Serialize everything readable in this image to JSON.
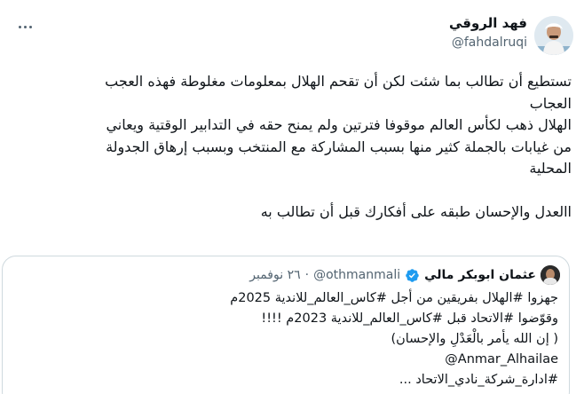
{
  "author": {
    "name": "فهد الروقي",
    "handle": "@fahdalruqi"
  },
  "tweet_lines": [
    "تستطيع أن تطالب بما شئت لكن أن تقحم الهلال بمعلومات مغلوطة فهذه العجب",
    "العجاب",
    "الهلال ذهب لكأس العالم موقوفا فترتين ولم يمنح حقه في التدابير الوقتية ويعاني",
    "من غيابات بالجملة كثير منها بسبب المشاركة مع المنتخب وبسبب إرهاق الجدولة",
    "المحلية",
    "",
    "االعدل والإحسان طبقه على أفكارك قبل أن تطالب به"
  ],
  "quote": {
    "name": "عثمان ابوبكر مالي",
    "handle": "@othmanmali",
    "separator": "·",
    "date": "٢٦ نوفمبر",
    "lines": [
      "جهزوا #الهلال بفريقين من أجل #كاس_العالم_للاندية 2025م",
      "وقوّضوا #الاتحاد قبل #كاس_العالم_للاندية 2023م !!!!",
      "( إن الله يأمر بالْعَدْلِ والإحسان)",
      "@Anmar_Alhailae",
      "#ادارة_شركة_نادي_الاتحاد ..."
    ]
  },
  "colors": {
    "text": "#0f1419",
    "secondary": "#536471",
    "border": "#cfd9de",
    "verified": "#1d9bf0"
  },
  "icons": {
    "more": "more-horizontal-icon",
    "verified": "verified-badge-icon"
  }
}
